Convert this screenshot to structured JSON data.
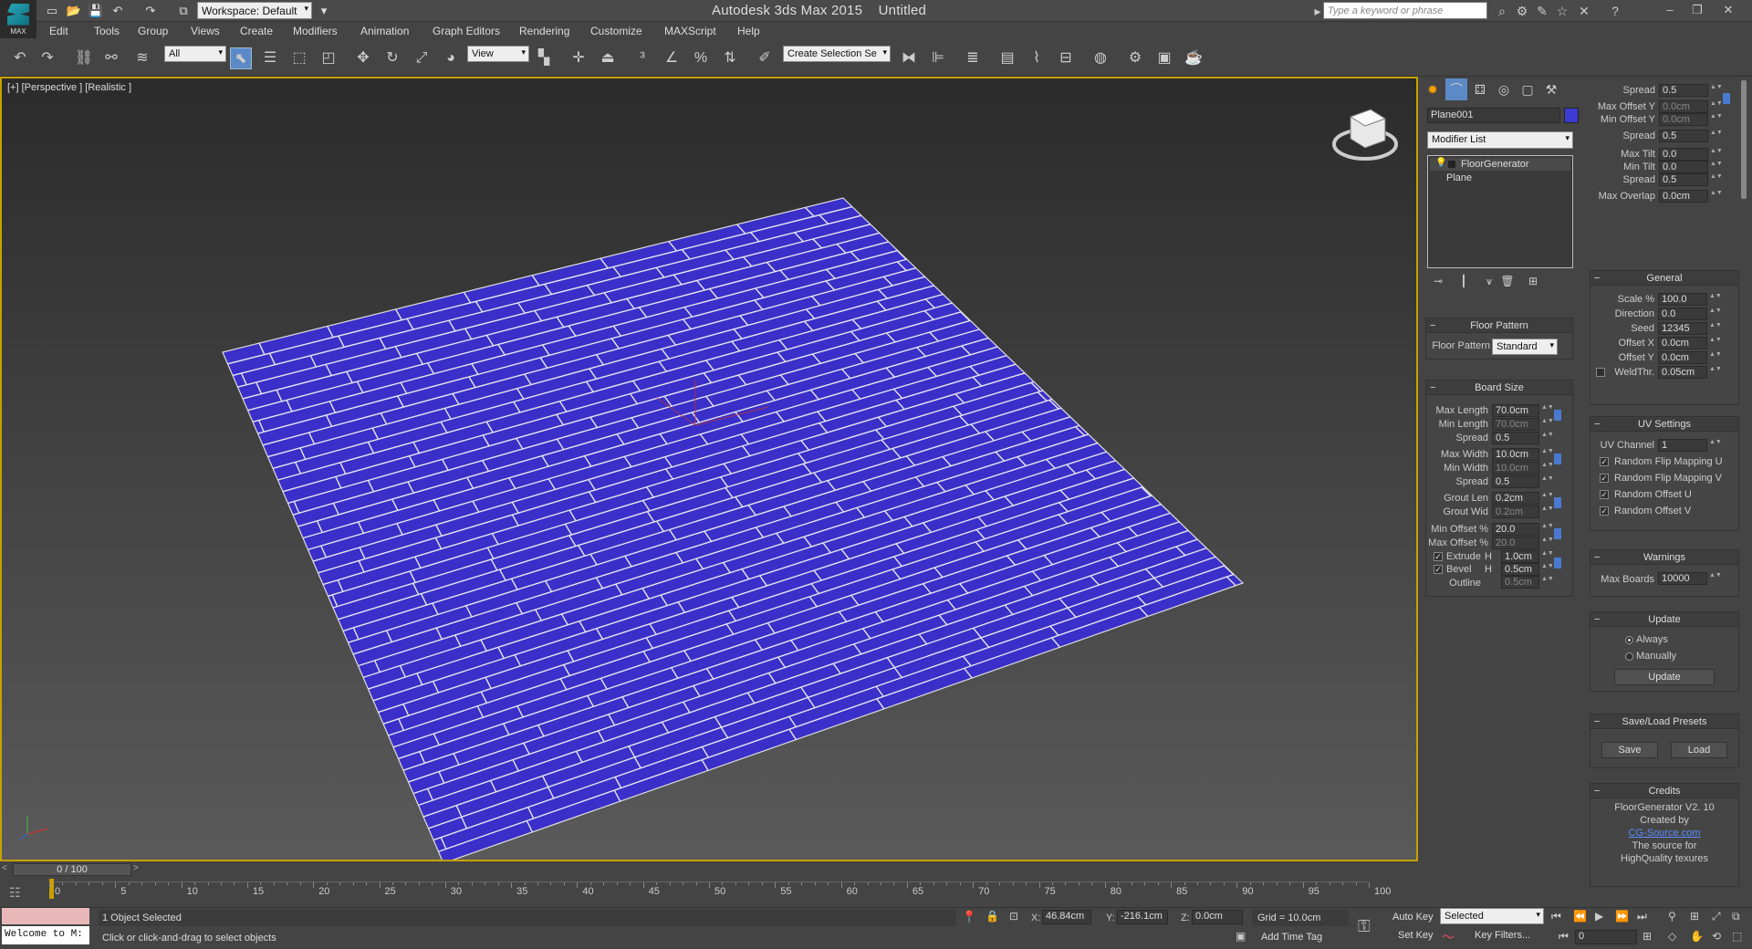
{
  "app": {
    "title": "Autodesk 3ds Max  2015",
    "document": "Untitled",
    "logo_text": "MAX",
    "workspace": "Workspace: Default",
    "search_placeholder": "Type a keyword or phrase"
  },
  "menu": [
    "Edit",
    "Tools",
    "Group",
    "Views",
    "Create",
    "Modifiers",
    "Animation",
    "Graph Editors",
    "Rendering",
    "Customize",
    "MAXScript",
    "Help"
  ],
  "toolbar": {
    "filter": "All",
    "ref_coord": "View",
    "selection_set": "Create Selection Se"
  },
  "viewport": {
    "label": "[+] [Perspective ] [Realistic ]",
    "floor_color": "#3a2fc8"
  },
  "command_panel": {
    "object_name": "Plane001",
    "object_color": "#3d3bd4",
    "modifier_list": "Modifier List",
    "stack": [
      "FloorGenerator",
      "Plane"
    ],
    "floor_pattern": {
      "title": "Floor Pattern",
      "label": "Floor Pattern",
      "value": "Standard"
    },
    "board_size": {
      "title": "Board Size",
      "rows": [
        {
          "label": "Max Length",
          "value": "70.0cm"
        },
        {
          "label": "Min Length",
          "value": "70.0cm"
        },
        {
          "label": "Spread",
          "value": "0.5"
        },
        {
          "label": "Max Width",
          "value": "10.0cm"
        },
        {
          "label": "Min Width",
          "value": "10.0cm"
        },
        {
          "label": "Spread",
          "value": "0.5"
        },
        {
          "label": "Grout Len",
          "value": "0.2cm"
        },
        {
          "label": "Grout Wid",
          "value": "0.2cm"
        },
        {
          "label": "Min Offset %",
          "value": "20.0"
        },
        {
          "label": "Max Offset %",
          "value": "20.0"
        }
      ],
      "extrude_label": "Extrude",
      "extrude_h": "1.0cm",
      "bevel_label": "Bevel",
      "bevel_h": "0.5cm",
      "outline_label": "Outline",
      "outline": "0.5cm",
      "h_label": "H"
    },
    "right_top": [
      {
        "label": "Spread",
        "value": "0.5"
      },
      {
        "label": "Max Offset Y",
        "value": "0.0cm"
      },
      {
        "label": "Min Offset Y",
        "value": "0.0cm"
      },
      {
        "label": "Spread",
        "value": "0.5"
      },
      {
        "label": "Max Tilt",
        "value": "0.0"
      },
      {
        "label": "Min Tilt",
        "value": "0.0"
      },
      {
        "label": "Spread",
        "value": "0.5"
      },
      {
        "label": "Max Overlap",
        "value": "0.0cm"
      }
    ],
    "general": {
      "title": "General",
      "rows": [
        {
          "label": "Scale %",
          "value": "100.0"
        },
        {
          "label": "Direction",
          "value": "0.0"
        },
        {
          "label": "Seed",
          "value": "12345"
        },
        {
          "label": "Offset X",
          "value": "0.0cm"
        },
        {
          "label": "Offset Y",
          "value": "0.0cm"
        },
        {
          "label": "WeldThr.",
          "value": "0.05cm"
        }
      ]
    },
    "uv": {
      "title": "UV Settings",
      "channel_label": "UV Channel",
      "channel": "1",
      "checks": [
        "Random Flip Mapping U",
        "Random Flip Mapping V",
        "Random Offset U",
        "Random Offset V"
      ]
    },
    "warnings": {
      "title": "Warnings",
      "label": "Max Boards",
      "value": "10000"
    },
    "update": {
      "title": "Update",
      "always": "Always",
      "manually": "Manually",
      "button": "Update"
    },
    "presets": {
      "title": "Save/Load Presets",
      "save": "Save",
      "load": "Load"
    },
    "credits": {
      "title": "Credits",
      "lines": [
        "FloorGenerator V2. 10",
        "Created by",
        "CG-Source.com",
        "The source for",
        "HighQuality texures"
      ]
    }
  },
  "timeline": {
    "frame": "0 / 100",
    "ticks": [
      "0",
      "5",
      "10",
      "15",
      "20",
      "25",
      "30",
      "35",
      "40",
      "45",
      "50",
      "55",
      "60",
      "65",
      "70",
      "75",
      "80",
      "85",
      "90",
      "95",
      "100"
    ]
  },
  "status": {
    "maxscript": "Welcome to M:",
    "selection": "1 Object Selected",
    "prompt": "Click or click-and-drag to select objects",
    "x_label": "X:",
    "x": "46.84cm",
    "y_label": "Y:",
    "y": "-216.1cm",
    "z_label": "Z:",
    "z": "0.0cm",
    "grid": "Grid = 10.0cm",
    "add_time_tag": "Add Time Tag",
    "auto_key": "Auto Key",
    "set_key": "Set Key",
    "selected": "Selected",
    "key_filters": "Key Filters...",
    "frame": "0"
  }
}
